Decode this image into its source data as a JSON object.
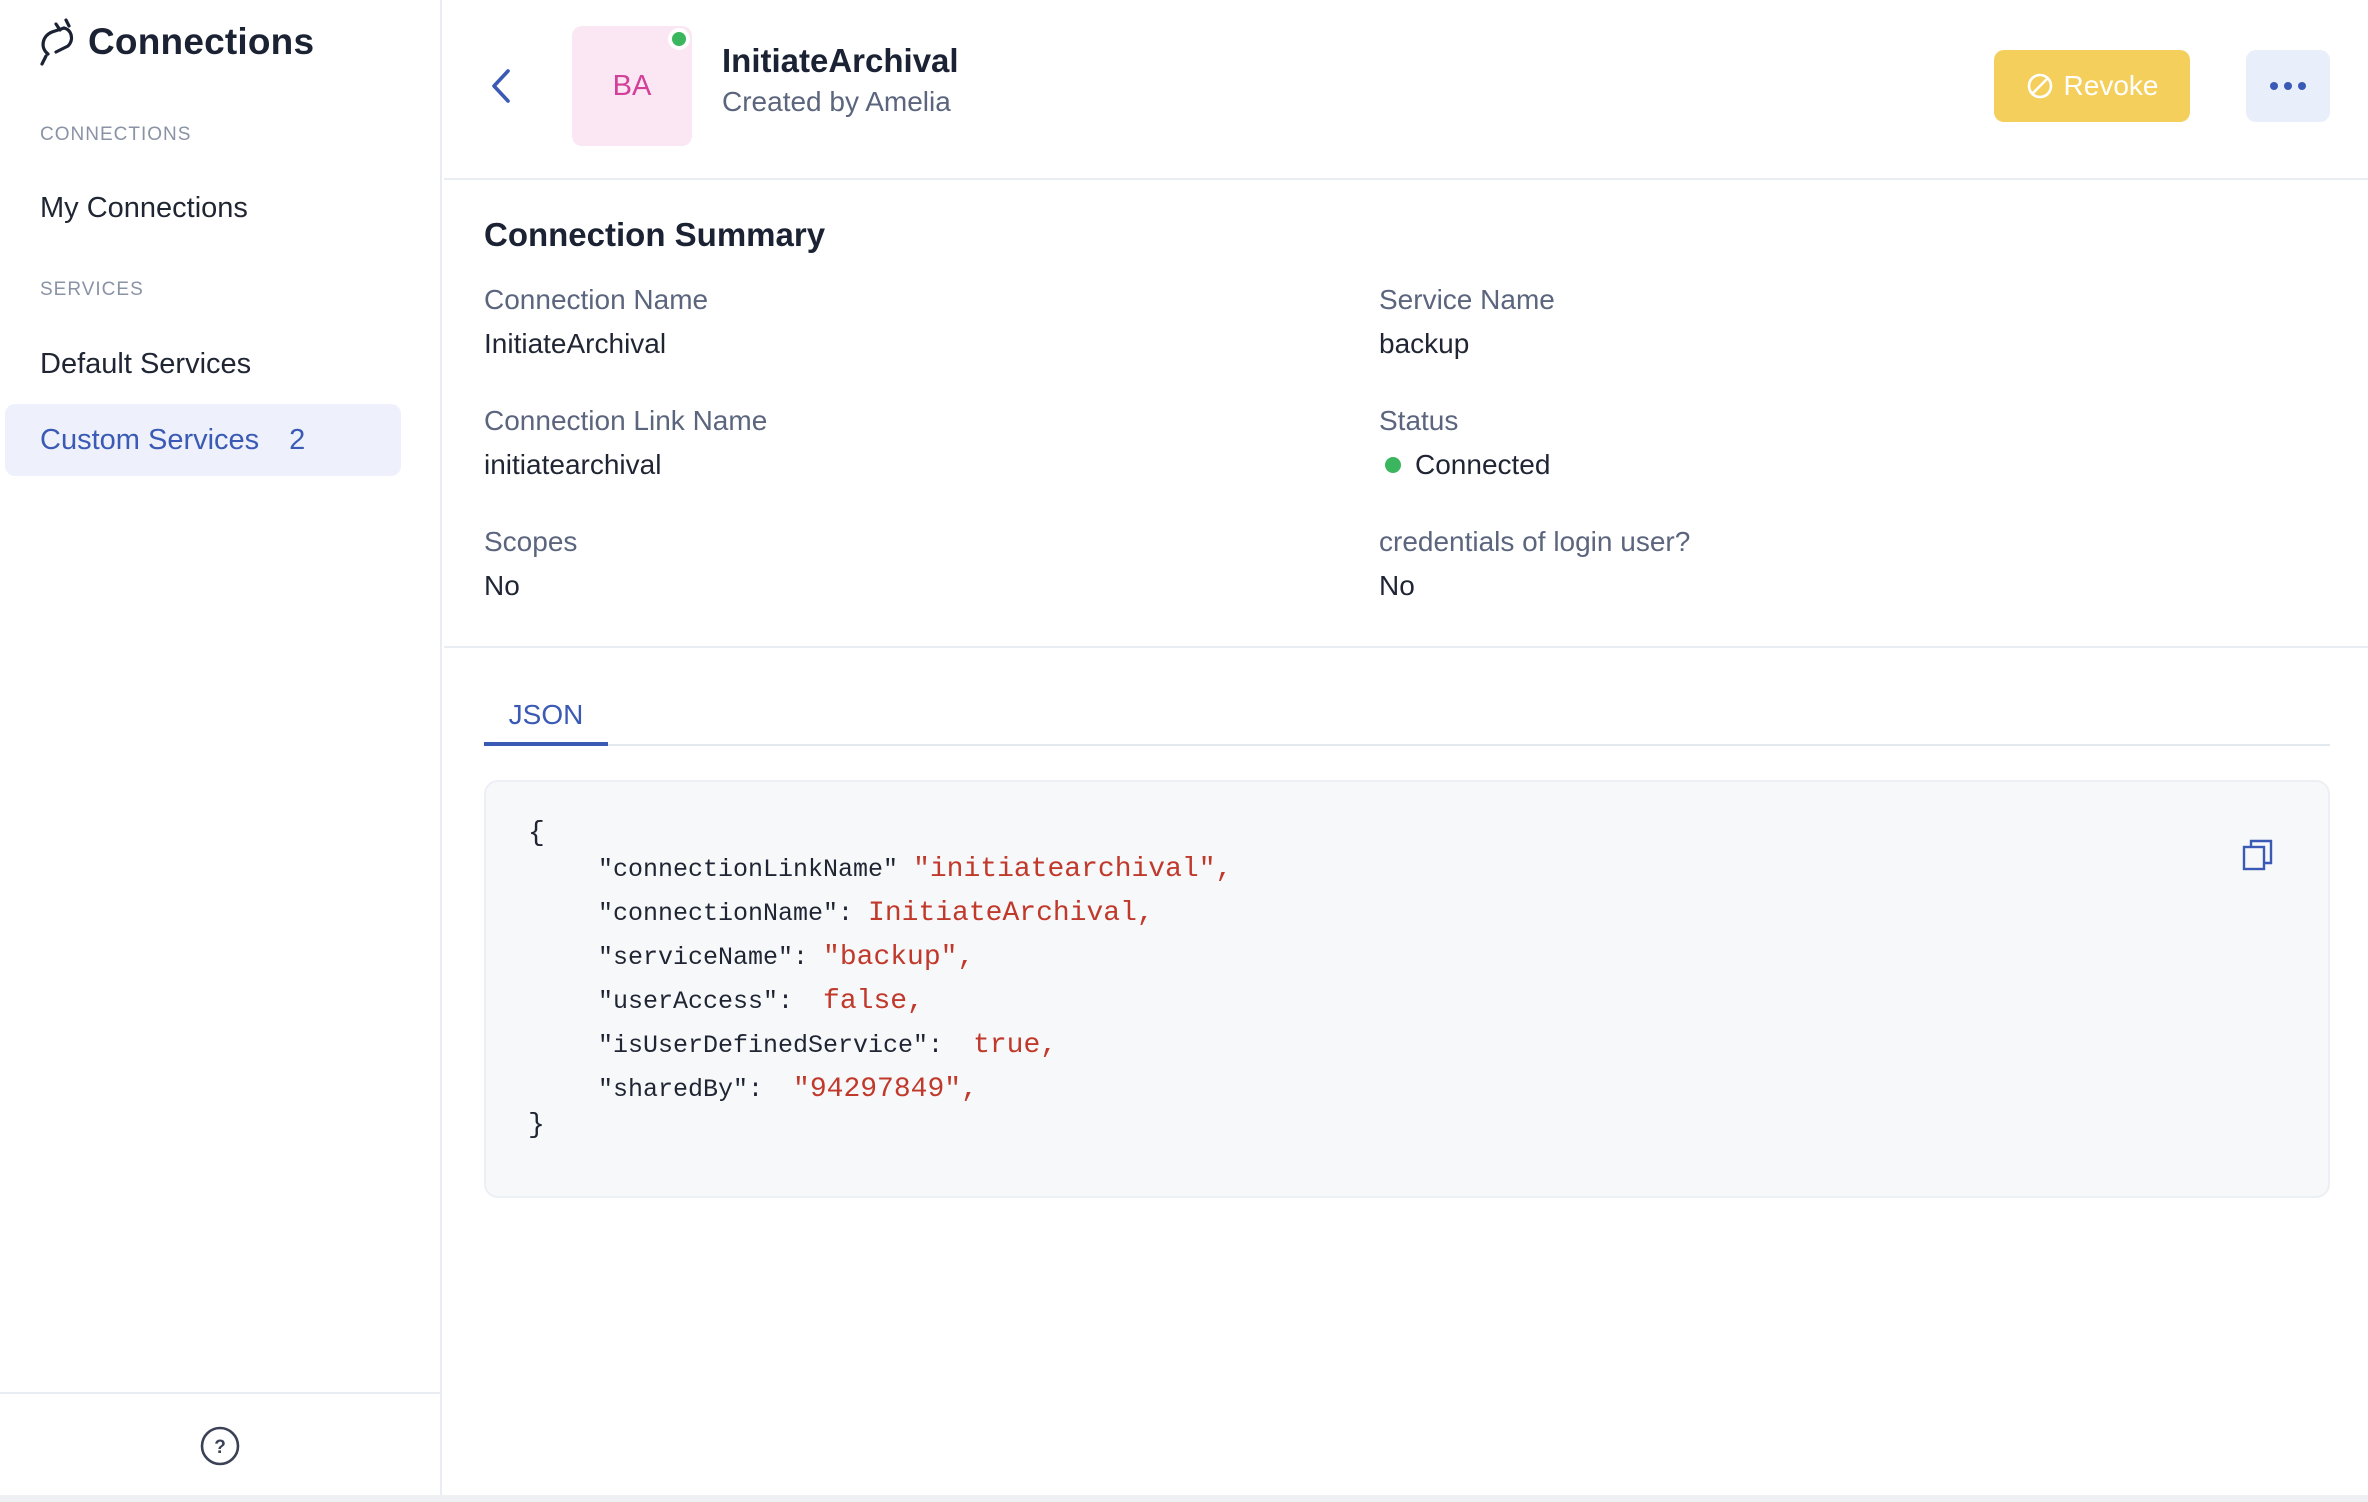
{
  "sidebar": {
    "title": "Connections",
    "section_connections": "CONNECTIONS",
    "section_services": "SERVICES",
    "items": {
      "my_connections": "My Connections",
      "default_services": "Default Services",
      "custom_services": "Custom Services",
      "custom_services_count": "2"
    },
    "help_glyph": "?"
  },
  "header": {
    "avatar_initials": "BA",
    "title": "InitiateArchival",
    "subtitle": "Created by Amelia",
    "revoke_label": "Revoke"
  },
  "summary": {
    "title": "Connection Summary",
    "fields": {
      "connection_name": {
        "label": "Connection Name",
        "value": "InitiateArchival"
      },
      "service_name": {
        "label": "Service Name",
        "value": "backup"
      },
      "connection_link_name": {
        "label": "Connection Link Name",
        "value": "initiatearchival"
      },
      "status": {
        "label": "Status",
        "value": "Connected"
      },
      "scopes": {
        "label": "Scopes",
        "value": "No"
      },
      "login_credentials": {
        "label": "credentials of login user?",
        "value": "No"
      }
    }
  },
  "tabs": {
    "json": "JSON"
  },
  "json_view": {
    "open": "{",
    "close": "}",
    "lines": [
      {
        "key": "\"connectionLinkName\" ",
        "value": "\"initiatearchival\","
      },
      {
        "key": "\"connectionName\": ",
        "value": "InitiateArchival,"
      },
      {
        "key": "\"serviceName\": ",
        "value": "\"backup\","
      },
      {
        "key": "\"userAccess\":  ",
        "value": "false,"
      },
      {
        "key": "\"isUserDefinedService\":  ",
        "value": "true,"
      },
      {
        "key": "\"sharedBy\":  ",
        "value": "\"94297849\","
      }
    ]
  },
  "colors": {
    "accent": "#3a5ab5",
    "revoke": "#f5cf5c",
    "status_connected": "#3bb55e",
    "json_value": "#c0392b"
  },
  "icons": [
    "plug-icon",
    "help-icon",
    "back-chevron-icon",
    "revoke-icon",
    "more-icon",
    "copy-icon",
    "status-dot"
  ]
}
